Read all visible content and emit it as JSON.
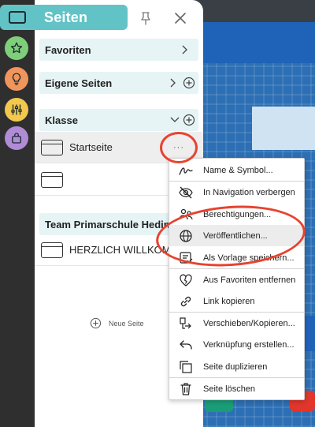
{
  "header": {
    "title": "Seiten"
  },
  "sections": {
    "favorites": {
      "label": "Favoriten"
    },
    "own_pages": {
      "label": "Eigene Seiten"
    },
    "class": {
      "label": "Klasse"
    },
    "team": {
      "label": "Team Primarschule Hedin"
    }
  },
  "pages": {
    "startseite": {
      "label": "Startseite",
      "more": "···"
    },
    "untitled": {
      "label": ""
    },
    "welcome": {
      "label": "HERZLICH WILLKOMM"
    }
  },
  "new_page": {
    "label": "Neue Seite"
  },
  "menu": {
    "items": [
      {
        "label": "Name & Symbol...",
        "icon": "signature-icon"
      },
      {
        "label": "In Navigation verbergen",
        "icon": "eye-off-icon"
      },
      {
        "label": "Berechtigungen...",
        "icon": "users-icon"
      },
      {
        "label": "Veröffentlichen...",
        "icon": "globe-icon"
      },
      {
        "label": "Als Vorlage speichern...",
        "icon": "template-icon"
      },
      {
        "label": "Aus Favoriten entfernen",
        "icon": "heart-broken-icon"
      },
      {
        "label": "Link kopieren",
        "icon": "link-icon"
      },
      {
        "label": "Verschieben/Kopieren...",
        "icon": "move-icon"
      },
      {
        "label": "Verknüpfung erstellen...",
        "icon": "shortcut-icon"
      },
      {
        "label": "Seite duplizieren",
        "icon": "duplicate-icon"
      },
      {
        "label": "Seite löschen",
        "icon": "trash-icon"
      }
    ]
  },
  "colors": {
    "accent": "#62c3c6",
    "section_bg": "#e6f4f5",
    "annotation": "#e8432f"
  }
}
